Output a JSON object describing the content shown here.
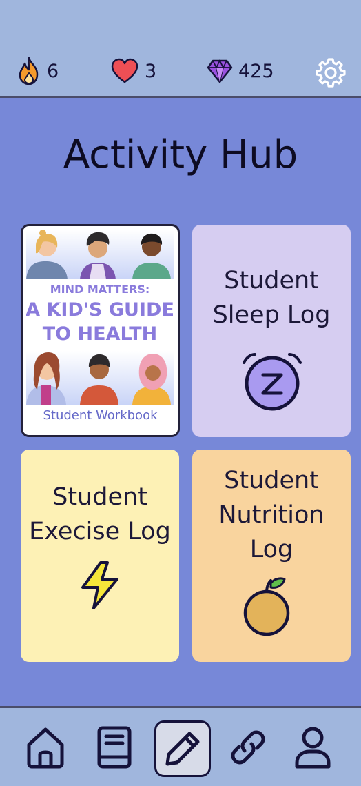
{
  "stats": {
    "streak": "6",
    "lives": "3",
    "gems": "425"
  },
  "page": {
    "title": "Activity Hub"
  },
  "cards": {
    "workbook": {
      "cover_line1": "MIND MATTERS:",
      "cover_line2": "A KID'S GUIDE",
      "cover_line3": "TO HEALTH",
      "caption": "Student Workbook"
    },
    "sleep": {
      "line1": "Student",
      "line2": "Sleep Log",
      "icon": "sleep-z-icon"
    },
    "exercise": {
      "line1": "Student",
      "line2": "Execise Log",
      "icon": "lightning-icon"
    },
    "nutrition": {
      "line1": "Student",
      "line2": "Nutrition",
      "line3": "Log",
      "icon": "orange-icon"
    }
  },
  "nav": {
    "items": [
      "home-icon",
      "book-icon",
      "pencil-icon",
      "link-icon",
      "profile-icon"
    ],
    "active": "pencil-icon"
  },
  "colors": {
    "background": "#7788d8",
    "bars": "#a0b6dd",
    "sleep_card": "#d6cdf1",
    "exercise_card": "#fdf1b5",
    "nutrition_card": "#f9d49e",
    "accent_purple": "#8a7bdc"
  }
}
